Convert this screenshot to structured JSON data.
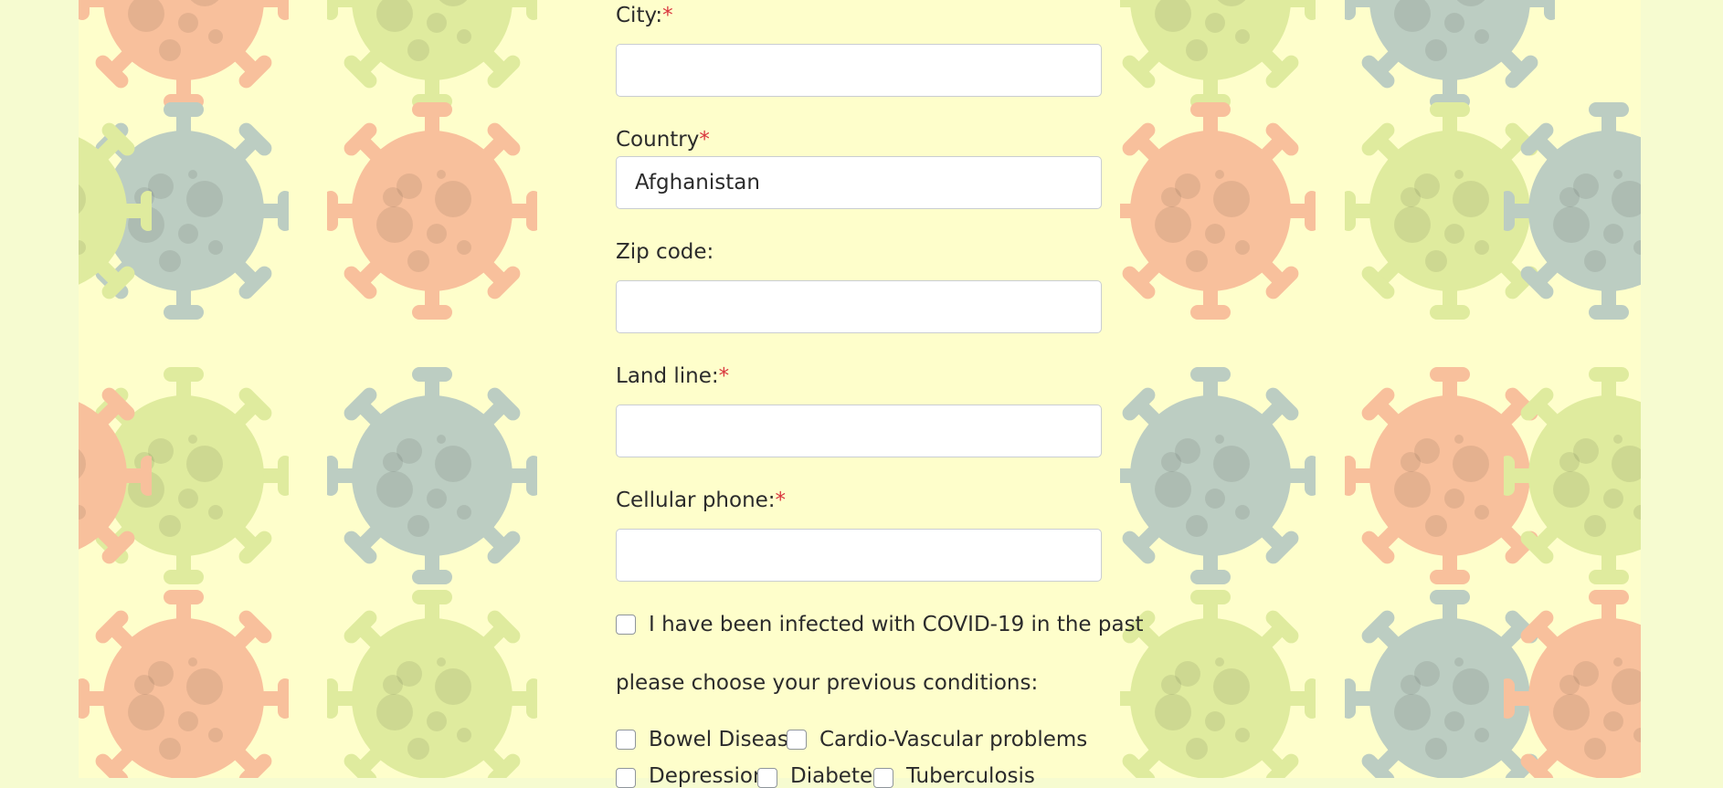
{
  "form": {
    "city": {
      "label": "City:",
      "required_mark": "*",
      "value": ""
    },
    "country": {
      "label": "Country",
      "required_mark": "*",
      "value": "Afghanistan"
    },
    "zip": {
      "label": "Zip code:",
      "value": ""
    },
    "land_line": {
      "label": "Land line:",
      "required_mark": "*",
      "value": ""
    },
    "cellular": {
      "label": "Cellular phone:",
      "required_mark": "*",
      "value": ""
    },
    "infected": {
      "label": "I have been infected with COVID-19 in the past",
      "checked": false
    },
    "conditions_prompt": "please choose your previous conditions:",
    "conditions": [
      {
        "label": "Bowel Disease",
        "checked": false
      },
      {
        "label": "Cardio-Vascular problems",
        "checked": false
      },
      {
        "label": "Depression",
        "checked": false
      },
      {
        "label": "Diabetes",
        "checked": false
      },
      {
        "label": "Tuberculosis",
        "checked": false
      }
    ]
  },
  "colors": {
    "page_background": "#f6fbd0",
    "pattern_background": "#fefecb",
    "required_mark": "#d9363e",
    "virus_gray": "#bccdc2",
    "virus_green": "#dfeb9e",
    "virus_orange": "#f8c09c"
  },
  "icons": [
    "virus-icon",
    "checkbox-icon"
  ]
}
